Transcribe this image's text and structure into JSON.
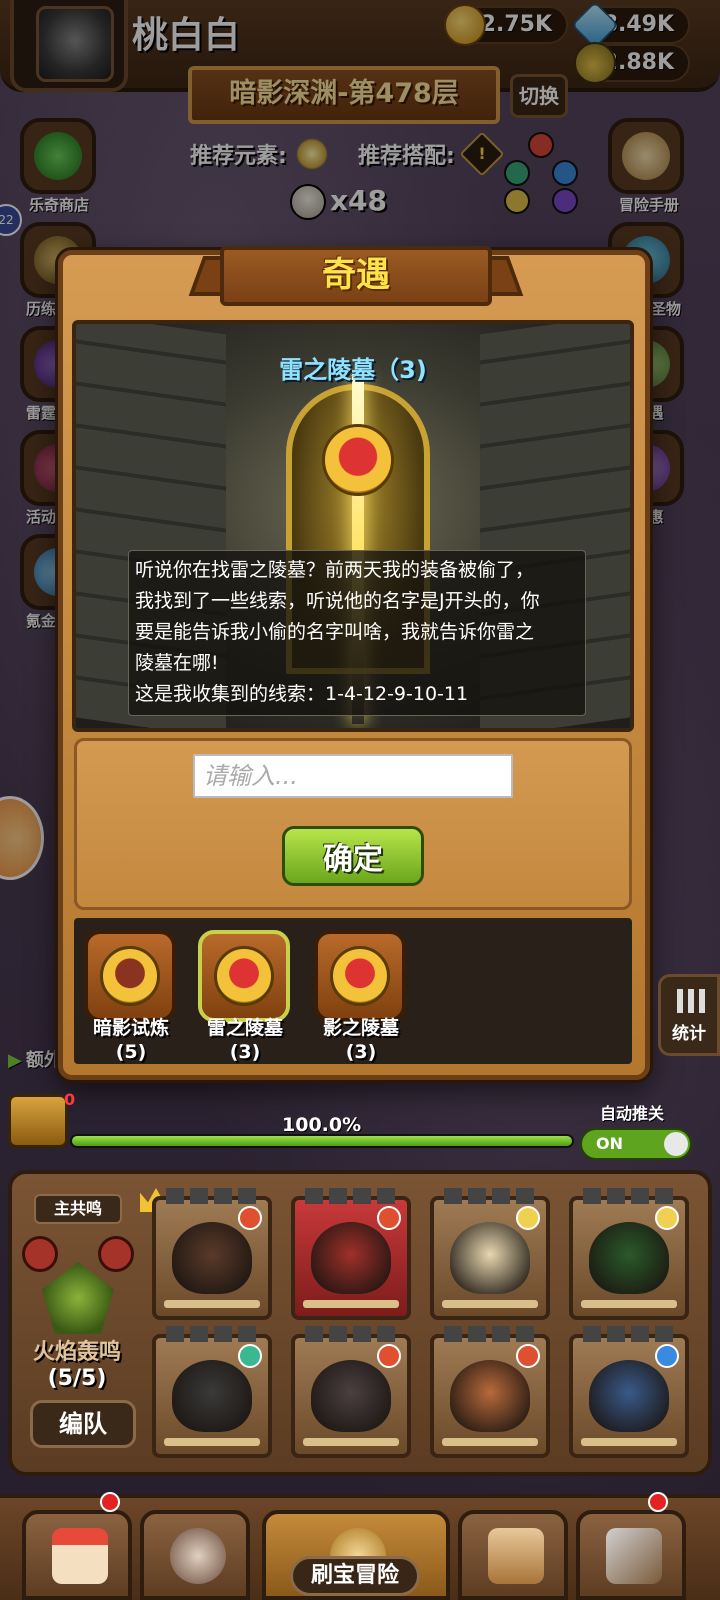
{
  "player": {
    "name": "桃白白",
    "avatar_icon": "knight-helmet-icon"
  },
  "resources": {
    "gold": "12.75K",
    "diamond": "8.49K",
    "potion": "12.88K"
  },
  "stage": {
    "floor_title": "暗影深渊-第478层",
    "switch_label": "切换",
    "recommend_element_label": "推荐元素:",
    "recommend_combo_label": "推荐搭配:",
    "enemy_count": "x48"
  },
  "side_menu_left": [
    {
      "label": "乐奇商店",
      "icon": "clover-icon"
    },
    {
      "label": "历练",
      "icon": "vase-icon"
    },
    {
      "label": "雷霆",
      "icon": "orb-icon"
    },
    {
      "label": "活动",
      "icon": "gift-icon"
    },
    {
      "label": "氪金",
      "icon": "crystal-icon"
    }
  ],
  "side_menu_right": [
    {
      "label": "冒险手册",
      "icon": "scroll-icon"
    },
    {
      "label": "圣物",
      "icon": "relic-icon"
    },
    {
      "label": "遇",
      "icon": "scroll2-icon"
    },
    {
      "label": "惠",
      "icon": "chest-icon"
    }
  ],
  "badge_left": "22",
  "encounter": {
    "title": "奇遇",
    "scene_title": "雷之陵墓（3)",
    "story_lines": [
      "听说你在找雷之陵墓？前两天我的装备被偷了，",
      "我找到了一些线索，听说他的名字是J开头的，你",
      "要是能告诉我小偷的名字叫啥，我就告诉你雷之",
      "陵墓在哪!",
      "这是我收集到的线索：1-4-12-9-10-11"
    ],
    "input_placeholder": "请输入...",
    "confirm_label": "确定",
    "tabs": [
      {
        "name": "暗影试炼",
        "count": "(5)",
        "active": false,
        "icon": "book-emblem-icon"
      },
      {
        "name": "雷之陵墓",
        "count": "(3)",
        "active": true,
        "icon": "demon-emblem-icon"
      },
      {
        "name": "影之陵墓",
        "count": "(3)",
        "active": false,
        "icon": "demon-emblem-icon"
      }
    ]
  },
  "progress": {
    "percent_text": "100.0%",
    "value": 1.0,
    "chest_badge": "0",
    "bonus_label": "额外",
    "auto_push_label": "自动推关",
    "auto_push_state": "ON",
    "stats_label": "统计"
  },
  "team": {
    "resonance_tag": "主共鸣",
    "team_name": "火焰轰鸣",
    "team_count": "(5/5)",
    "formation_label": "编队",
    "heroes": [
      {
        "id": "hero-1",
        "element": "fire",
        "color": "#5a3a2a"
      },
      {
        "id": "hero-2",
        "element": "fire",
        "color": "#a0302a"
      },
      {
        "id": "hero-3",
        "element": "light",
        "color": "#e8d8b0"
      },
      {
        "id": "hero-4",
        "element": "light",
        "color": "#2a5a2a"
      },
      {
        "id": "hero-5",
        "element": "wind",
        "color": "#3a3a3a"
      },
      {
        "id": "hero-6",
        "element": "fire",
        "color": "#4a4040"
      },
      {
        "id": "hero-7",
        "element": "fire",
        "color": "#b86a3a"
      },
      {
        "id": "hero-8",
        "element": "water",
        "color": "#3a5a8a"
      }
    ]
  },
  "bottom_nav": {
    "center_label": "刷宝冒险",
    "items": [
      "shop-icon",
      "hero-icon",
      "adventure-map-icon",
      "bag-icon",
      "forge-icon"
    ]
  },
  "colors": {
    "title_yellow": "#ffe34a",
    "scene_title_blue": "#8fe3ff",
    "confirm_green": "#7cc027",
    "panel_brown": "#c4883e"
  }
}
